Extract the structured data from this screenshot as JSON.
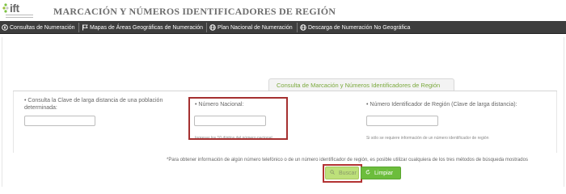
{
  "header": {
    "logo_text": "ift",
    "title": "MARCACIÓN Y NÚMEROS IDENTIFICADORES DE REGIÓN"
  },
  "nav": {
    "items": [
      {
        "label": "Consultas de Numeración",
        "icon": "compass-icon"
      },
      {
        "label": "Mapas de Áreas Geográficas de Numeración",
        "icon": "flag-icon"
      },
      {
        "label": "Plan Nacional de Numeración",
        "icon": "globe-icon"
      },
      {
        "label": "Descarga de Numeración No Geográfica",
        "icon": "globe-icon"
      }
    ]
  },
  "tab": {
    "label": "Consulta de Marcación y Números Identificadores de Región"
  },
  "form": {
    "col1": {
      "label": "• Consulta la Clave de larga distancia de una población determinada:",
      "value": ""
    },
    "col2": {
      "label": "• Número Nacional:",
      "value": "",
      "hint": "Ingresar los 10 dígitos del número nacional"
    },
    "col3": {
      "label": "• Número Identificador de Región (Clave de larga distancia):",
      "value": "",
      "hint": "Si sólo se requiere información de un número identificador de región"
    }
  },
  "note": "*Para obtener información de algún número telefónico o de un número identificador de región, es posible utilizar cualquiera de los tres métodos de búsqueda mostrados",
  "buttons": {
    "search_label": "Buscar",
    "clear_label": "Limpiar"
  },
  "colors": {
    "nav_bg": "#3d3d3d",
    "accent_green": "#6cbd3c",
    "tab_text": "#7aa93c",
    "highlight_red": "#a53030"
  }
}
